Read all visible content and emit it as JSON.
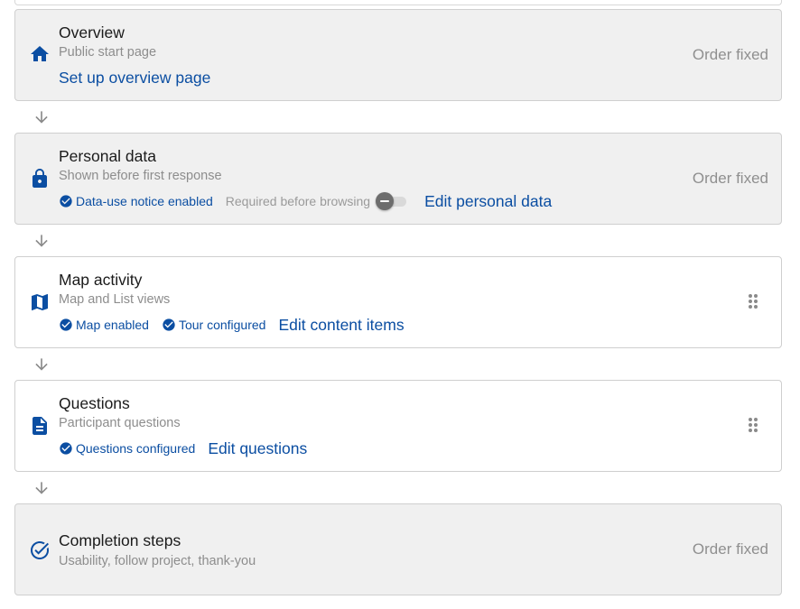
{
  "steps": [
    {
      "title": "Overview",
      "subtitle": "Public start page",
      "icon": "home-icon",
      "edit_label": "Set up overview page",
      "order_label": "Order fixed"
    },
    {
      "title": "Personal data",
      "subtitle": "Shown before first response",
      "icon": "lock-icon",
      "badges": [
        "Data-use notice enabled"
      ],
      "toggle_label": "Required before browsing",
      "toggle_on": false,
      "edit_label": "Edit personal data",
      "order_label": "Order fixed"
    },
    {
      "title": "Map activity",
      "subtitle": "Map and List views",
      "icon": "map-icon",
      "badges": [
        "Map enabled",
        "Tour configured"
      ],
      "edit_label": "Edit content items"
    },
    {
      "title": "Questions",
      "subtitle": "Participant questions",
      "icon": "document-icon",
      "badges": [
        "Questions configured"
      ],
      "edit_label": "Edit questions"
    },
    {
      "title": "Completion steps",
      "subtitle": "Usability, follow project, thank-you",
      "icon": "check-circle-icon",
      "order_label": "Order fixed"
    }
  ],
  "colors": {
    "accent": "#0b4ea2",
    "fixed_card_bg": "#f0f0f0",
    "muted_text": "#8d8d8d"
  }
}
